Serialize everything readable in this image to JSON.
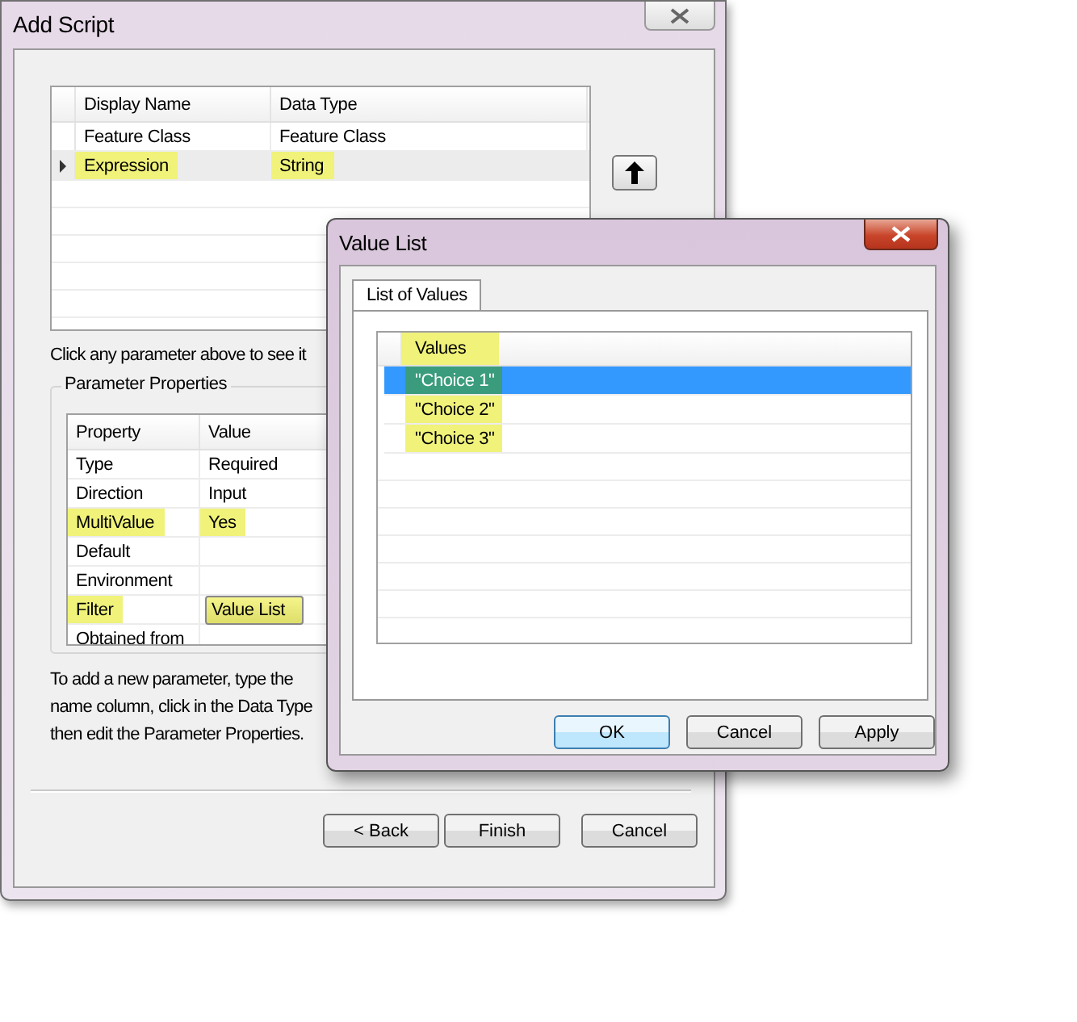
{
  "add_script": {
    "title": "Add Script",
    "parameters_table": {
      "columns": [
        "Display Name",
        "Data Type"
      ],
      "rows": [
        {
          "selected": false,
          "current": false,
          "cells": [
            {
              "text": "Feature Class",
              "highlighted": false
            },
            {
              "text": "Feature Class",
              "highlighted": false
            }
          ]
        },
        {
          "selected": true,
          "current": true,
          "cells": [
            {
              "text": "Expression",
              "highlighted": true
            },
            {
              "text": "String",
              "highlighted": true
            }
          ]
        }
      ]
    },
    "hint": "Click any parameter above to see it",
    "properties": {
      "title": "Parameter Properties",
      "columns": [
        "Property",
        "Value"
      ],
      "rows": [
        {
          "property": {
            "text": "Type",
            "highlighted": false
          },
          "value": {
            "kind": "text",
            "text": "Required",
            "highlighted": false
          }
        },
        {
          "property": {
            "text": "Direction",
            "highlighted": false
          },
          "value": {
            "kind": "text",
            "text": "Input",
            "highlighted": false
          }
        },
        {
          "property": {
            "text": "MultiValue",
            "highlighted": true
          },
          "value": {
            "kind": "text",
            "text": "Yes",
            "highlighted": true
          }
        },
        {
          "property": {
            "text": "Default",
            "highlighted": false
          }
        },
        {
          "property": {
            "text": "Environment",
            "highlighted": false
          }
        },
        {
          "property": {
            "text": "Filter",
            "highlighted": true
          },
          "value": {
            "kind": "dropdown",
            "text": "Value List",
            "highlighted": true
          }
        },
        {
          "property": {
            "text": "Obtained from",
            "highlighted": false
          }
        }
      ]
    },
    "instructions": [
      "To add a new parameter, type the",
      "name column, click in the Data Type",
      "then edit the Parameter Properties."
    ],
    "buttons": [
      {
        "label": "< Back"
      },
      {
        "label": "Finish"
      },
      {
        "label": "Cancel"
      }
    ]
  },
  "value_list": {
    "title": "Value List",
    "tab": {
      "label": "List of Values",
      "selected": true
    },
    "column": {
      "text": "Values",
      "highlighted": true
    },
    "values": [
      {
        "text": "\"Choice 1\"",
        "selected": true,
        "highlighted": true
      },
      {
        "text": "\"Choice 2\"",
        "selected": false,
        "highlighted": true
      },
      {
        "text": "\"Choice 3\"",
        "selected": false,
        "highlighted": true
      }
    ],
    "buttons": [
      {
        "label": "OK",
        "default": true
      },
      {
        "label": "Cancel",
        "default": false
      },
      {
        "label": "Apply",
        "default": false
      }
    ]
  }
}
